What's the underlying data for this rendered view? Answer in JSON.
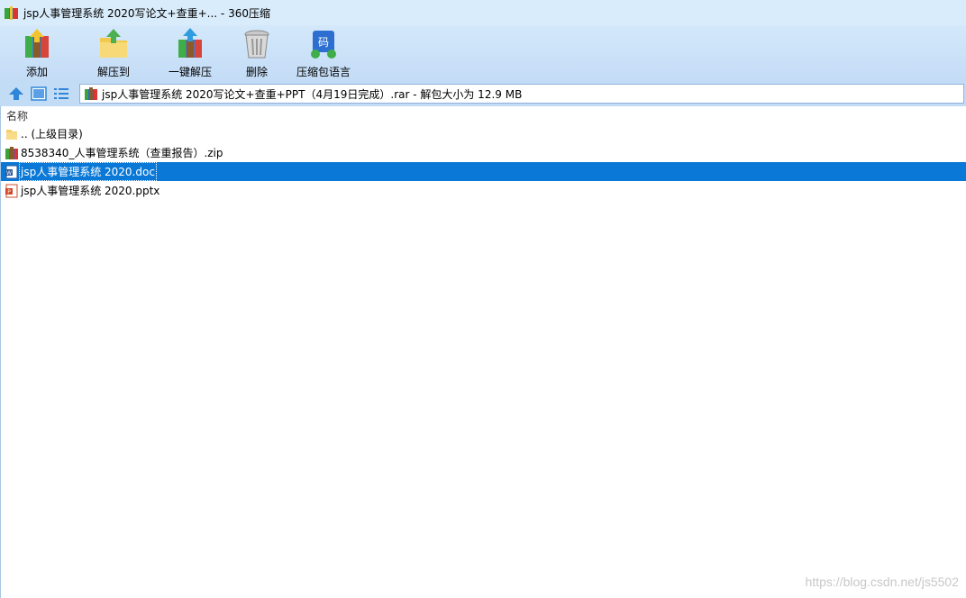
{
  "window": {
    "title": "jsp人事管理系统 2020写论文+查重+... - 360压缩"
  },
  "toolbar": {
    "items": [
      {
        "label": "添加",
        "icon": "add-archive-icon"
      },
      {
        "label": "解压到",
        "icon": "extract-to-icon"
      },
      {
        "label": "一键解压",
        "icon": "one-click-extract-icon"
      },
      {
        "label": "删除",
        "icon": "delete-trash-icon"
      },
      {
        "label": "压缩包语言",
        "icon": "archive-language-icon"
      }
    ]
  },
  "navbar": {
    "path": "jsp人事管理系统 2020写论文+查重+PPT（4月19日完成）.rar - 解包大小为 12.9 MB"
  },
  "filelist": {
    "column_name": "名称",
    "rows": [
      {
        "name": ".. (上级目录)",
        "icon": "folder-icon"
      },
      {
        "name": "8538340_人事管理系统（查重报告）.zip",
        "icon": "zip-archive-icon"
      },
      {
        "name": "jsp人事管理系统 2020.doc",
        "icon": "word-doc-icon",
        "selected": true
      },
      {
        "name": "jsp人事管理系统 2020.pptx",
        "icon": "powerpoint-icon"
      }
    ]
  },
  "watermark": "https://blog.csdn.net/js5502",
  "colors": {
    "selection": "#0a78d7",
    "toolbar": "#c3dcf6"
  }
}
